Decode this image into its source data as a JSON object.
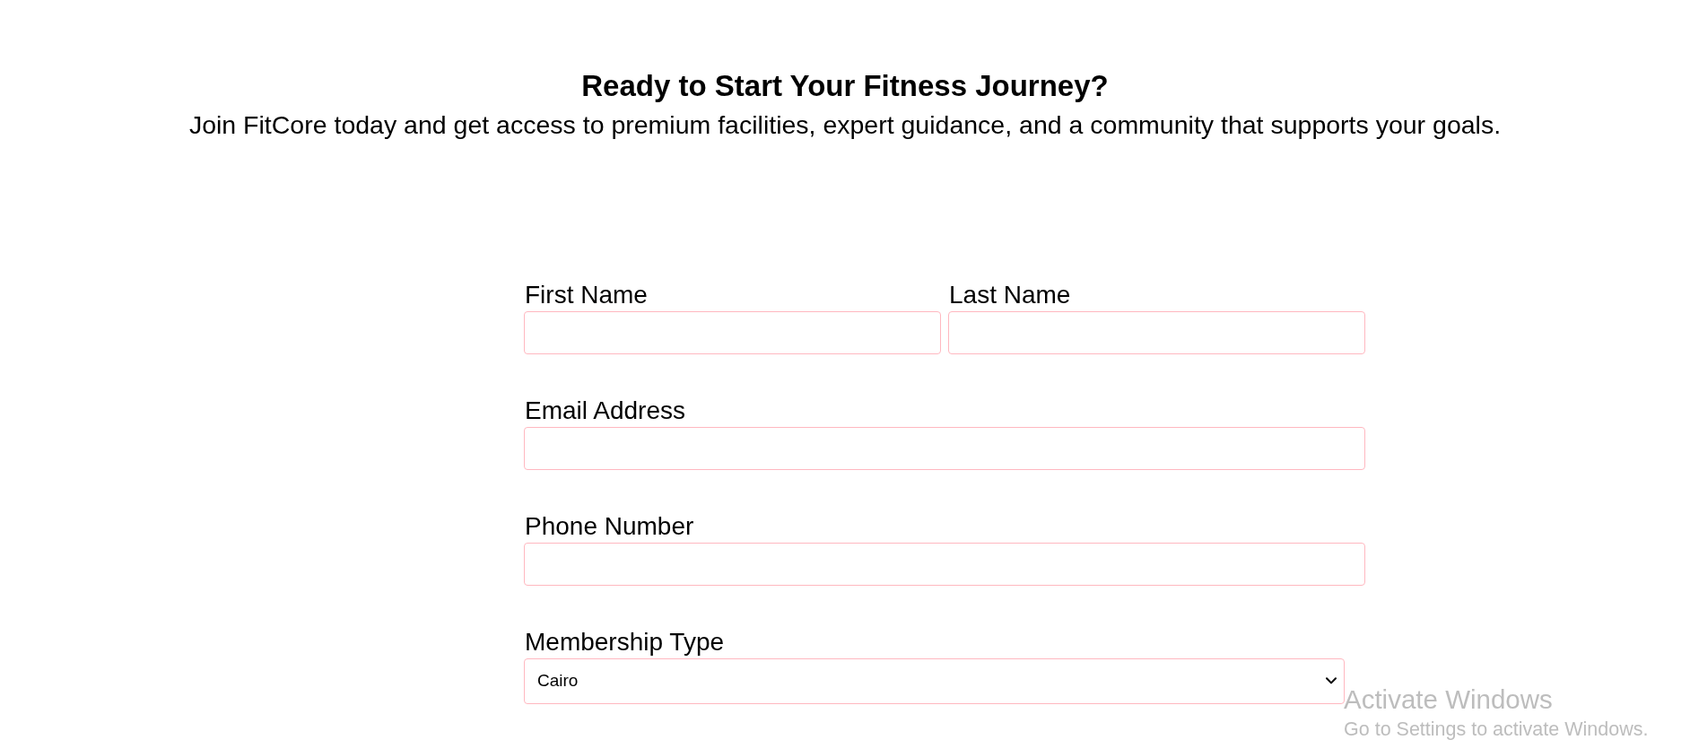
{
  "header": {
    "title": "Ready to Start Your Fitness Journey?",
    "subtitle": "Join FitCore today and get access to premium facilities, expert guidance, and a community that supports your goals."
  },
  "form": {
    "rows": [
      {
        "fields": [
          {
            "label": "First Name",
            "kind": "input"
          },
          {
            "label": "Last Name",
            "kind": "input"
          }
        ]
      },
      {
        "fields": [
          {
            "label": "Email Address",
            "kind": "input"
          }
        ]
      },
      {
        "fields": [
          {
            "label": "Phone Number",
            "kind": "input"
          }
        ]
      },
      {
        "fields": [
          {
            "label": "Membership Type",
            "kind": "select",
            "value": "Cairo"
          }
        ]
      }
    ]
  },
  "os_overlay": {
    "title": "Activate Windows",
    "message": "Go to Settings to activate Windows."
  }
}
